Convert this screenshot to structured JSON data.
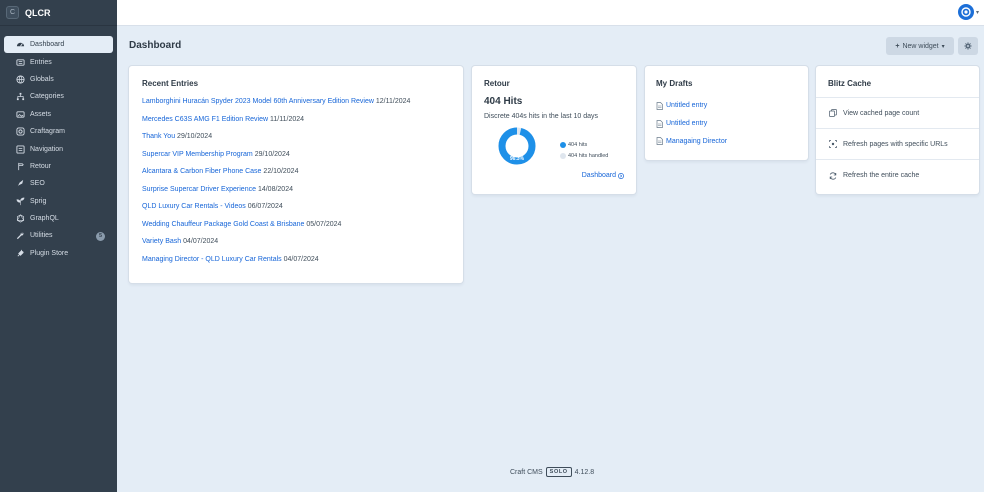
{
  "site": {
    "logo_letter": "C",
    "name": "QLCR"
  },
  "nav": [
    {
      "label": "Dashboard",
      "icon": "gauge-icon",
      "active": true
    },
    {
      "label": "Entries",
      "icon": "newspaper-icon"
    },
    {
      "label": "Globals",
      "icon": "globe-icon"
    },
    {
      "label": "Categories",
      "icon": "sitemap-icon"
    },
    {
      "label": "Assets",
      "icon": "image-icon"
    },
    {
      "label": "Craftagram",
      "icon": "instagram-icon"
    },
    {
      "label": "Navigation",
      "icon": "navigation-icon"
    },
    {
      "label": "Retour",
      "icon": "signpost-icon"
    },
    {
      "label": "SEO",
      "icon": "rocket-icon"
    },
    {
      "label": "Sprig",
      "icon": "sprig-icon"
    },
    {
      "label": "GraphQL",
      "icon": "graphql-icon"
    },
    {
      "label": "Utilities",
      "icon": "wrench-icon",
      "badge": "5"
    },
    {
      "label": "Plugin Store",
      "icon": "plug-icon"
    }
  ],
  "header": {
    "title": "Dashboard",
    "new_widget_label": "New widget"
  },
  "recent_entries": {
    "title": "Recent Entries",
    "items": [
      {
        "title": "Lamborghini Huracán Spyder 2023 Model 60th Anniversary Edition Review",
        "date": "12/11/2024"
      },
      {
        "title": "Mercedes C63S AMG F1 Edition Review",
        "date": "11/11/2024"
      },
      {
        "title": "Thank You",
        "date": "29/10/2024"
      },
      {
        "title": "Supercar VIP Membership Program",
        "date": "29/10/2024"
      },
      {
        "title": "Alcantara & Carbon Fiber Phone Case",
        "date": "22/10/2024"
      },
      {
        "title": "Surprise Supercar Driver Experience",
        "date": "14/08/2024"
      },
      {
        "title": "QLD Luxury Car Rentals - Videos",
        "date": "06/07/2024"
      },
      {
        "title": "Wedding Chauffeur Package Gold Coast & Brisbane",
        "date": "05/07/2024"
      },
      {
        "title": "Variety Bash",
        "date": "04/07/2024"
      },
      {
        "title": "Managing Director - QLD Luxury Car Rentals",
        "date": "04/07/2024"
      }
    ]
  },
  "retour": {
    "title": "Retour",
    "hits_label": "404 Hits",
    "subtitle": "Discrete 404s hits in the last 10 days",
    "percent_label": "96.3%",
    "handled_fraction": 0.037,
    "legend": [
      {
        "label": "404 hits",
        "color": "#1e90e8"
      },
      {
        "label": "404 hits handled",
        "color": "#dfe6ee"
      }
    ],
    "link_label": "Dashboard"
  },
  "drafts": {
    "title": "My Drafts",
    "items": [
      "Untitled entry",
      "Untitled entry",
      "Managaing Director"
    ]
  },
  "blitz": {
    "title": "Blitz Cache",
    "actions": [
      {
        "label": "View cached page count",
        "icon": "copy-icon"
      },
      {
        "label": "Refresh pages with specific URLs",
        "icon": "scan-icon"
      },
      {
        "label": "Refresh the entire cache",
        "icon": "refresh-icon"
      }
    ]
  },
  "footer": {
    "product": "Craft CMS",
    "edition": "SOLO",
    "version": "4.12.8"
  },
  "colors": {
    "sidebar": "#33404d",
    "link": "#1665d8",
    "background": "#e4edf6",
    "donut": "#1e90e8"
  }
}
